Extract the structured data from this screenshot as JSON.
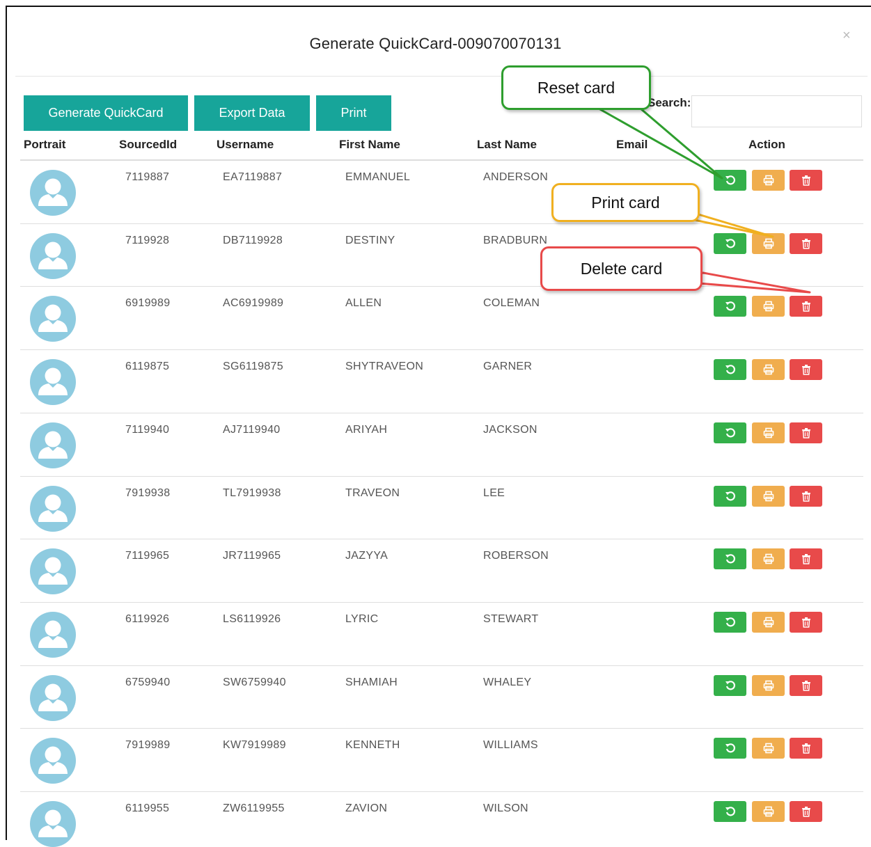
{
  "modal": {
    "title": "Generate QuickCard-009070070131",
    "close_glyph": "×"
  },
  "toolbar": {
    "generate_label": "Generate QuickCard",
    "export_label": "Export Data",
    "print_label": "Print",
    "search_label": "Search:",
    "search_value": ""
  },
  "columns": [
    "Portrait",
    "SourcedId",
    "Username",
    "First Name",
    "Last Name",
    "Email",
    "Action"
  ],
  "rows": [
    {
      "sourced_id": "7119887",
      "username": "EA7119887",
      "first": "EMMANUEL",
      "last": "ANDERSON",
      "email": ""
    },
    {
      "sourced_id": "7119928",
      "username": "DB7119928",
      "first": "DESTINY",
      "last": "BRADBURN",
      "email": ""
    },
    {
      "sourced_id": "6919989",
      "username": "AC6919989",
      "first": "ALLEN",
      "last": "COLEMAN",
      "email": ""
    },
    {
      "sourced_id": "6119875",
      "username": "SG6119875",
      "first": "SHYTRAVEON",
      "last": "GARNER",
      "email": ""
    },
    {
      "sourced_id": "7119940",
      "username": "AJ7119940",
      "first": "ARIYAH",
      "last": "JACKSON",
      "email": ""
    },
    {
      "sourced_id": "7919938",
      "username": "TL7919938",
      "first": "TRAVEON",
      "last": "LEE",
      "email": ""
    },
    {
      "sourced_id": "7119965",
      "username": "JR7119965",
      "first": "JAZYYA",
      "last": "ROBERSON",
      "email": ""
    },
    {
      "sourced_id": "6119926",
      "username": "LS6119926",
      "first": "LYRIC",
      "last": "STEWART",
      "email": ""
    },
    {
      "sourced_id": "6759940",
      "username": "SW6759940",
      "first": "SHAMIAH",
      "last": "WHALEY",
      "email": ""
    },
    {
      "sourced_id": "7919989",
      "username": "KW7919989",
      "first": "KENNETH",
      "last": "WILLIAMS",
      "email": ""
    },
    {
      "sourced_id": "6119955",
      "username": "ZW6119955",
      "first": "ZAVION",
      "last": "WILSON",
      "email": ""
    }
  ],
  "icons": {
    "portrait": "user-silhouette-icon",
    "reset": "refresh-icon",
    "print": "printer-icon",
    "delete": "trash-icon"
  },
  "callouts": {
    "reset": "Reset card",
    "print": "Print card",
    "delete": "Delete card"
  },
  "colors": {
    "toolbar_button": "#17a59a",
    "reset_button": "#34b04a",
    "print_button": "#f0ad4e",
    "delete_button": "#e84a4a",
    "avatar": "#8ecbe0",
    "callout_reset_border": "#2e9e2e",
    "callout_print_border": "#f0b020",
    "callout_delete_border": "#e84a4a"
  }
}
